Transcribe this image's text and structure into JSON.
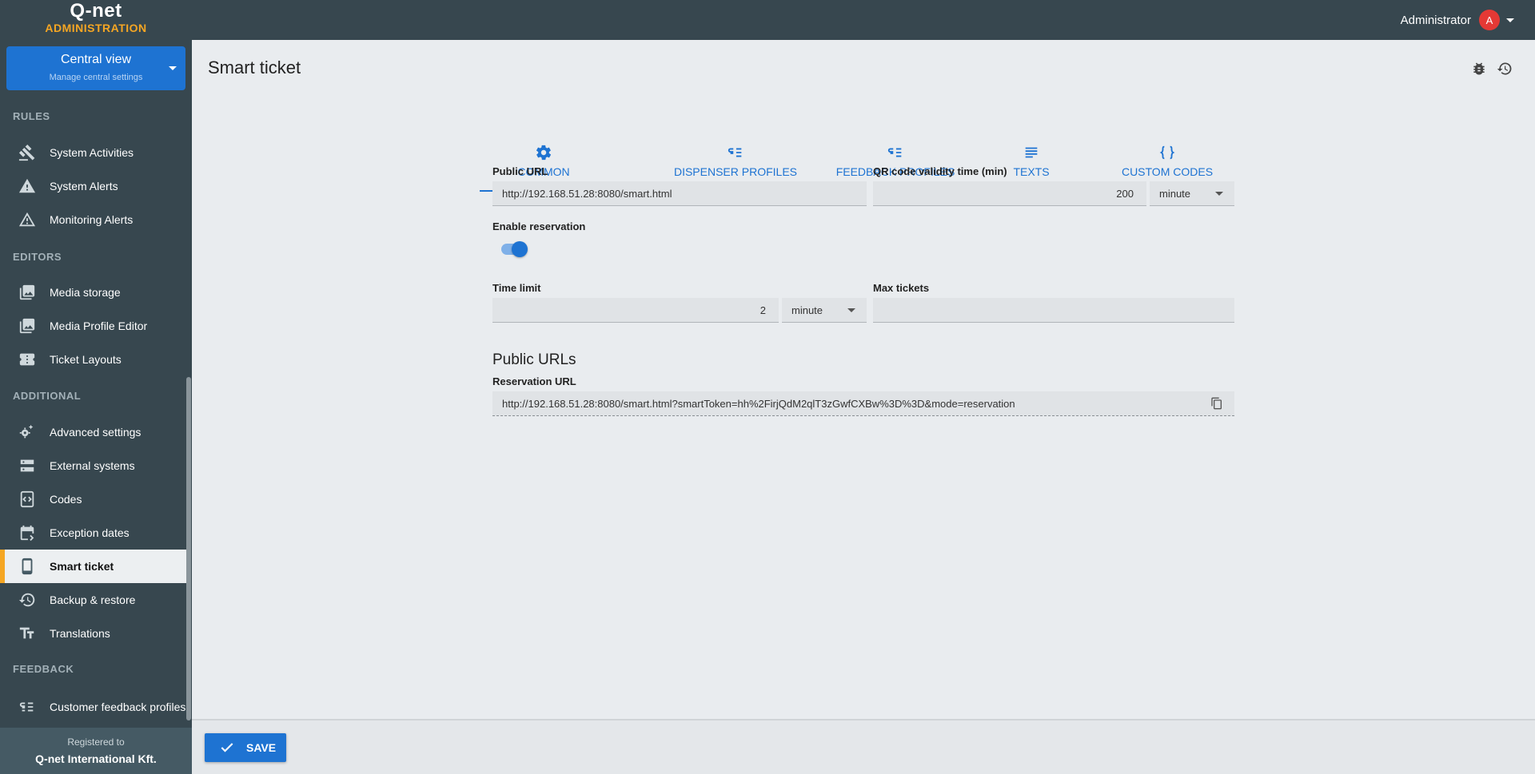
{
  "app": {
    "logo_top": "Q-net",
    "logo_bottom": "ADMINISTRATION",
    "accent": "#1e73d2",
    "brand_color": "#f5a623"
  },
  "user": {
    "name": "Administrator",
    "avatar": "A"
  },
  "central": {
    "title": "Central view",
    "subtitle": "Manage central settings"
  },
  "sidebar": {
    "sections": [
      "RULES",
      "EDITORS",
      "ADDITIONAL",
      "FEEDBACK"
    ],
    "items": [
      {
        "label": "System Activities",
        "icon": "gavel-icon"
      },
      {
        "label": "System Alerts",
        "icon": "warning-icon"
      },
      {
        "label": "Monitoring Alerts",
        "icon": "warning-outline-icon"
      },
      {
        "label": "Media storage",
        "icon": "photo-library-icon"
      },
      {
        "label": "Media Profile Editor",
        "icon": "photo-library-icon"
      },
      {
        "label": "Ticket Layouts",
        "icon": "ticket-icon"
      },
      {
        "label": "Advanced settings",
        "icon": "gears-icon"
      },
      {
        "label": "External systems",
        "icon": "server-icon"
      },
      {
        "label": "Codes",
        "icon": "code-icon"
      },
      {
        "label": "Exception dates",
        "icon": "calendar-icon"
      },
      {
        "label": "Smart ticket",
        "icon": "phone-icon"
      },
      {
        "label": "Backup & restore",
        "icon": "restore-icon"
      },
      {
        "label": "Translations",
        "icon": "text-size-icon"
      },
      {
        "label": "Customer feedback profiles",
        "icon": "feedback-list-icon"
      }
    ],
    "active": "Smart ticket",
    "registered_label": "Registered to",
    "registered_name": "Q-net International Kft."
  },
  "page": {
    "title": "Smart ticket"
  },
  "tabs": [
    "COMMON",
    "DISPENSER PROFILES",
    "FEEDBACK PROFILES",
    "TEXTS",
    "CUSTOM CODES"
  ],
  "form": {
    "public_url_label": "Public URL",
    "public_url_value": "http://192.168.51.28:8080/smart.html",
    "qr_label": "QR code validity time (min)",
    "qr_value": "200",
    "qr_unit": "minute",
    "reservation_label": "Enable reservation",
    "reservation_enabled": true,
    "time_limit_label": "Time limit",
    "time_limit_value": "2",
    "time_limit_unit": "minute",
    "max_tickets_label": "Max tickets",
    "max_tickets_value": ""
  },
  "public_urls": {
    "heading": "Public URLs",
    "reservation_label": "Reservation URL",
    "reservation_value": "http://192.168.51.28:8080/smart.html?smartToken=hh%2FirjQdM2qlT3zGwfCXBw%3D%3D&mode=reservation"
  },
  "footer": {
    "save_label": "SAVE"
  }
}
